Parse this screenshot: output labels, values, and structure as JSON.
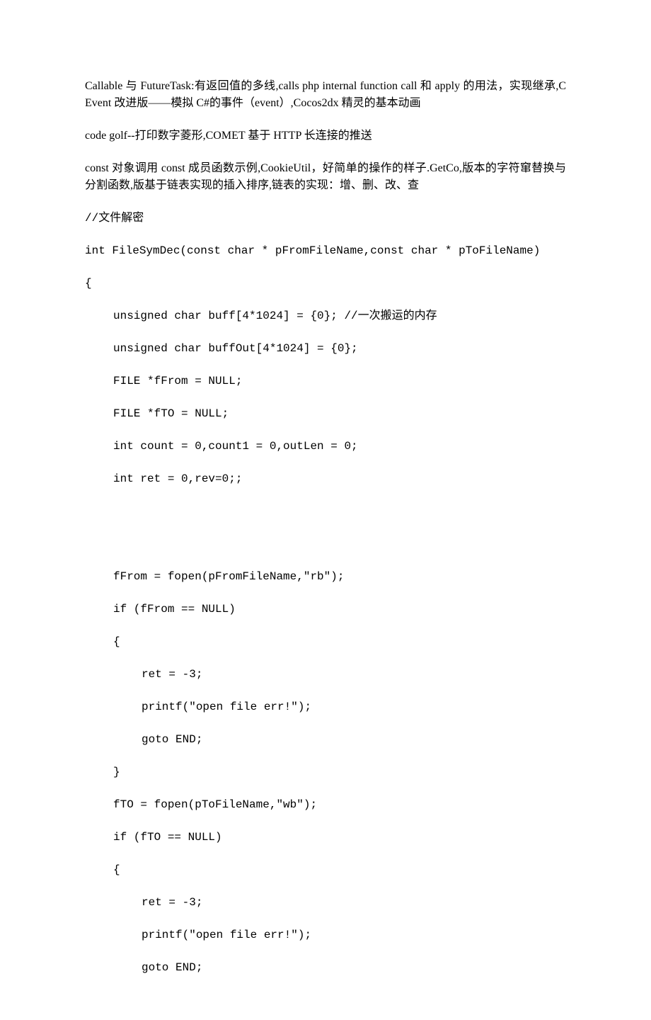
{
  "paragraphs": [
    "Callable 与 FutureTask:有返回值的多线,calls php internal function call 和 apply 的用法，实现继承,CEvent 改进版——模拟 C#的事件（event）,Cocos2dx 精灵的基本动画",
    "code golf--打印数字菱形,COMET 基于 HTTP 长连接的推送",
    "const 对象调用 const 成员函数示例,CookieUtil，好简单的操作的样子.GetCo,版本的字符窜替换与分割函数,版基于链表实现的插入排序,链表的实现：增、删、改、查"
  ],
  "code": {
    "comment": "//文件解密",
    "sig": "int FileSymDec(const char * pFromFileName,const char * pToFileName)",
    "open": "{",
    "lines": [
      {
        "indent": 1,
        "text": "unsigned char buff[4*1024] = {0}; //一次搬运的内存"
      },
      {
        "indent": 1,
        "text": "unsigned char buffOut[4*1024] = {0};"
      },
      {
        "indent": 1,
        "text": "FILE *fFrom = NULL;"
      },
      {
        "indent": 1,
        "text": "FILE *fTO = NULL;"
      },
      {
        "indent": 1,
        "text": "int count = 0,count1 = 0,outLen = 0;"
      },
      {
        "indent": 1,
        "text": "int ret = 0,rev=0;;"
      },
      {
        "indent": 1,
        "text": ""
      },
      {
        "indent": 1,
        "text": ""
      },
      {
        "indent": 1,
        "text": "fFrom = fopen(pFromFileName,\"rb\");"
      },
      {
        "indent": 1,
        "text": "if (fFrom == NULL)"
      },
      {
        "indent": 1,
        "text": "{"
      },
      {
        "indent": 2,
        "text": "ret = -3;"
      },
      {
        "indent": 2,
        "text": "printf(\"open file err!\");"
      },
      {
        "indent": 2,
        "text": "goto END;"
      },
      {
        "indent": 1,
        "text": "}"
      },
      {
        "indent": 1,
        "text": "fTO = fopen(pToFileName,\"wb\");"
      },
      {
        "indent": 1,
        "text": "if (fTO == NULL)"
      },
      {
        "indent": 1,
        "text": "{"
      },
      {
        "indent": 2,
        "text": "ret = -3;"
      },
      {
        "indent": 2,
        "text": "printf(\"open file err!\");"
      },
      {
        "indent": 2,
        "text": "goto END;"
      }
    ]
  }
}
